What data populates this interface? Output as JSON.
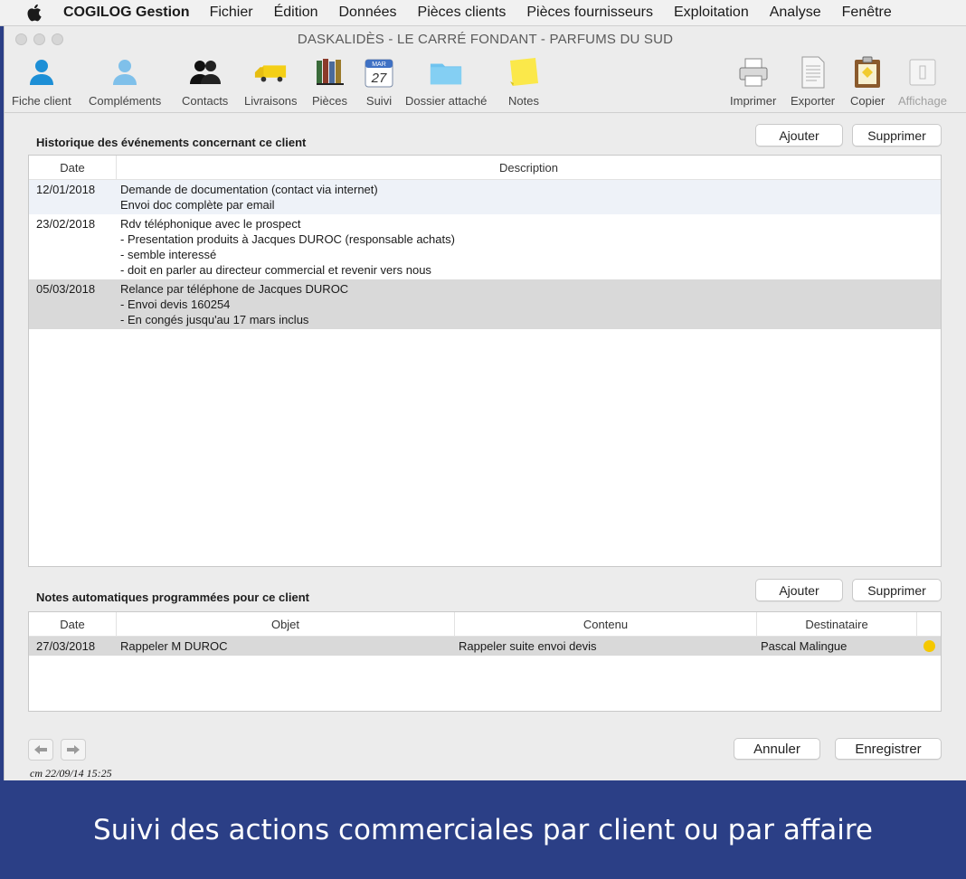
{
  "menubar": {
    "app_name": "COGILOG Gestion",
    "items": [
      "Fichier",
      "Édition",
      "Données",
      "Pièces clients",
      "Pièces fournisseurs",
      "Exploitation",
      "Analyse",
      "Fenêtre"
    ]
  },
  "window": {
    "title": "DASKALIDÈS - LE CARRÉ FONDANT - PARFUMS DU SUD"
  },
  "toolbar": {
    "left": [
      {
        "label": "Fiche client",
        "icon": "person-blue-icon"
      },
      {
        "label": "Compléments",
        "icon": "person-light-icon"
      },
      {
        "label": "Contacts",
        "icon": "contacts-icon"
      },
      {
        "label": "Livraisons",
        "icon": "truck-icon"
      },
      {
        "label": "Pièces",
        "icon": "books-icon"
      },
      {
        "label": "Suivi",
        "icon": "calendar-icon",
        "calendar_month": "MAR",
        "calendar_day": "27"
      },
      {
        "label": "Dossier attaché",
        "icon": "folder-icon"
      },
      {
        "label": "Notes",
        "icon": "sticky-note-icon"
      }
    ],
    "right": [
      {
        "label": "Imprimer",
        "icon": "printer-icon"
      },
      {
        "label": "Exporter",
        "icon": "document-icon"
      },
      {
        "label": "Copier",
        "icon": "clipboard-icon"
      },
      {
        "label": "Affichage",
        "icon": "display-icon",
        "disabled": true
      }
    ]
  },
  "history": {
    "title": "Historique des événements concernant ce client",
    "add_label": "Ajouter",
    "delete_label": "Supprimer",
    "columns": [
      "Date",
      "Description"
    ],
    "rows": [
      {
        "date": "12/01/2018",
        "lines": [
          "Demande de documentation (contact via internet)",
          "Envoi doc complète par email"
        ]
      },
      {
        "date": "23/02/2018",
        "lines": [
          "Rdv téléphonique avec le prospect",
          "- Presentation produits à Jacques DUROC (responsable achats)",
          "- semble interessé",
          "- doit en parler au directeur commercial et revenir vers nous"
        ]
      },
      {
        "date": "05/03/2018",
        "lines": [
          "Relance par téléphone de Jacques DUROC",
          "- Envoi devis 160254",
          "- En congés jusqu'au 17 mars inclus"
        ]
      }
    ]
  },
  "notes": {
    "title": "Notes automatiques programmées pour ce client",
    "add_label": "Ajouter",
    "delete_label": "Supprimer",
    "columns": [
      "Date",
      "Objet",
      "Contenu",
      "Destinataire"
    ],
    "rows": [
      {
        "date": "27/03/2018",
        "objet": "Rappeler M DUROC",
        "contenu": "Rappeler suite envoi devis",
        "destinataire": "Pascal Malingue",
        "status_color": "#f5c800"
      }
    ]
  },
  "footer": {
    "cancel_label": "Annuler",
    "save_label": "Enregistrer",
    "stamp": "cm 22/09/14 15:25"
  },
  "caption": "Suivi des actions commerciales par client ou par affaire"
}
